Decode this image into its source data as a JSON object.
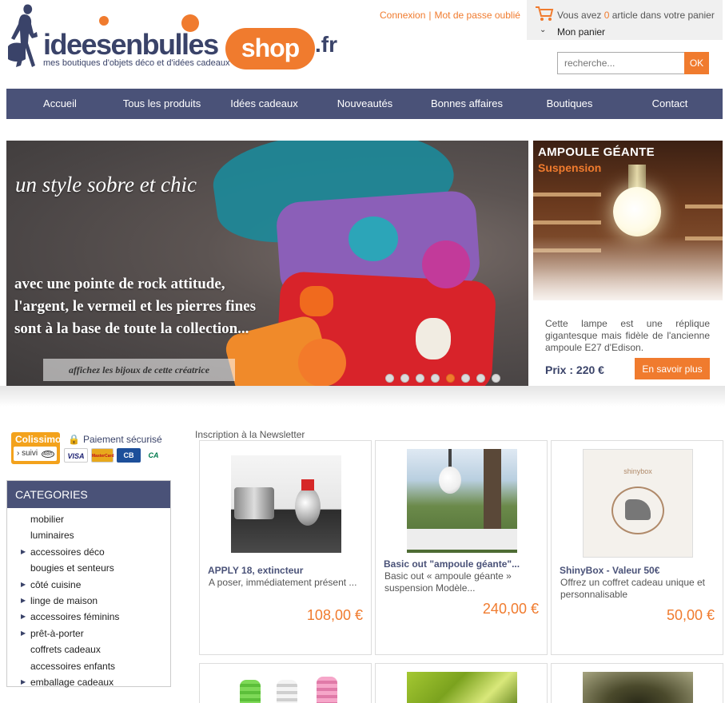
{
  "header": {
    "logo_main": "ideesenbulles",
    "logo_shop": "shop",
    "logo_tld": ".fr",
    "tagline": "mes boutiques d'objets déco et d'idées cadeaux",
    "login": "Connexion",
    "separator": "|",
    "forgot_password": "Mot de passe oublié",
    "cart_prefix": "Vous avez",
    "cart_count": "0",
    "cart_suffix": "article dans votre panier",
    "my_cart": "Mon panier",
    "search_placeholder": "recherche...",
    "search_button": "OK"
  },
  "nav": [
    {
      "label": "Accueil"
    },
    {
      "label": "Tous les produits"
    },
    {
      "label": "Idées cadeaux"
    },
    {
      "label": "Nouveautés"
    },
    {
      "label": "Bonnes affaires"
    },
    {
      "label": "Boutiques"
    },
    {
      "label": "Contact"
    }
  ],
  "hero": {
    "title": "un style sobre et chic",
    "line1": "avec une pointe de rock attitude,",
    "line2": "l'argent, le vermeil et les pierres fines",
    "line3": "sont à la base de toute la collection...",
    "cta": "affichez les bijoux de cette créatrice",
    "slide_count": 8,
    "active_slide": 4
  },
  "promo": {
    "title": "AMPOULE GÉANTE",
    "subtitle": "Suspension",
    "description": "Cette lampe est une réplique gigantesque mais fidèle de l'ancienne ampoule E27 d'Edison.",
    "price": "Prix : 220 €",
    "button": "En savoir plus"
  },
  "sidebar": {
    "colissimo": "Colissimo",
    "colissimo_suivi": "› suivi",
    "colissimo_badge": "48h",
    "secure_payment": "Paiement sécurisé",
    "cards": [
      "VISA",
      "MasterCard",
      "CB",
      "CA"
    ],
    "categories_title": "CATEGORIES",
    "categories": [
      {
        "label": "mobilier",
        "has_children": false
      },
      {
        "label": "luminaires",
        "has_children": false
      },
      {
        "label": "accessoires déco",
        "has_children": true
      },
      {
        "label": "bougies et senteurs",
        "has_children": false
      },
      {
        "label": "côté cuisine",
        "has_children": true
      },
      {
        "label": "linge de maison",
        "has_children": true
      },
      {
        "label": "accessoires féminins",
        "has_children": true
      },
      {
        "label": "prêt-à-porter",
        "has_children": true
      },
      {
        "label": "coffrets cadeaux",
        "has_children": false
      },
      {
        "label": "accessoires enfants",
        "has_children": false
      },
      {
        "label": "emballage cadeaux",
        "has_children": true
      }
    ]
  },
  "main": {
    "newsletter": "Inscription à la Newsletter",
    "products": [
      {
        "name": "APPLY 18, extincteur",
        "description": "A poser, immédiatement présent ...",
        "price": "108,00 €"
      },
      {
        "name": "Basic out \"ampoule géante\"...",
        "description": "Basic out « ampoule géante » suspension Modèle...",
        "price": "240,00 €"
      },
      {
        "name": "ShinyBox - Valeur 50€",
        "description": "Offrez un coffret cadeau unique et personnalisable",
        "price": "50,00 €"
      }
    ]
  },
  "colors": {
    "accent": "#f07b2e",
    "nav": "#4a5278",
    "brand_text": "#3a4369"
  }
}
